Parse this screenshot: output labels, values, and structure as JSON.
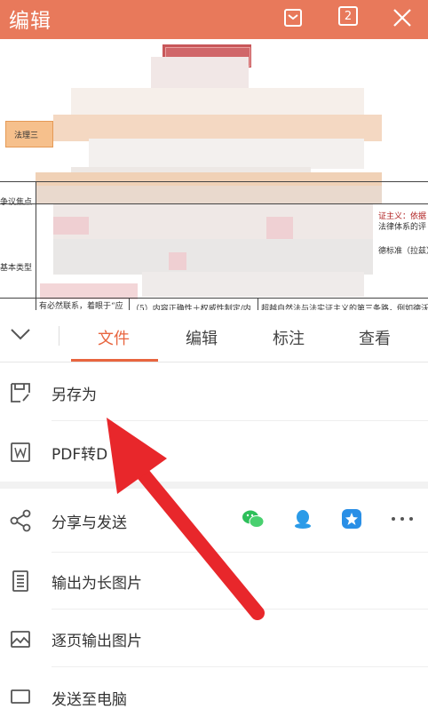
{
  "header": {
    "title": "编辑",
    "page_count": "2"
  },
  "document": {
    "box_label": "法理三",
    "label_issue": "争议焦点",
    "label_type": "基本类型",
    "snippet_left": "有必然联系，着眼于“应",
    "snippet_mid": "（5）内容正确性＋权威性制定/内",
    "snippet_right": "超越自然法与法实证主义的第三条路，例如德沃",
    "snippet_right_top": "证主义：依据",
    "snippet_right_mid": "法律体系的评",
    "snippet_right_bot": "德标准（拉兹）"
  },
  "tabs": [
    {
      "label": "文件"
    },
    {
      "label": "编辑"
    },
    {
      "label": "标注"
    },
    {
      "label": "查看"
    }
  ],
  "menu": {
    "save_as": "另存为",
    "pdf_convert": "PDF转D",
    "share": "分享与发送",
    "export_long_image": "输出为长图片",
    "export_page_images": "逐页输出图片",
    "send_to_pc": "发送至电脑"
  },
  "colors": {
    "accent": "#e8653f",
    "header_bg": "#e8795b",
    "arrow": "#e8272b"
  }
}
